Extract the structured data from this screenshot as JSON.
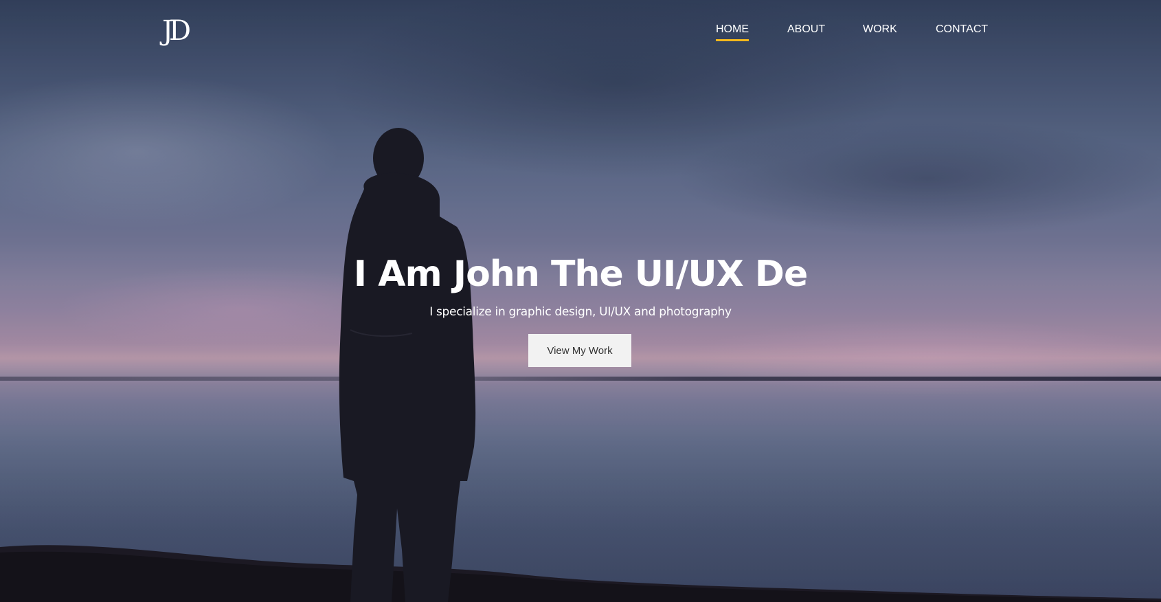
{
  "logo": {
    "text": "JD"
  },
  "nav": {
    "items": [
      {
        "label": "HOME",
        "active": true
      },
      {
        "label": "ABOUT",
        "active": false
      },
      {
        "label": "WORK",
        "active": false
      },
      {
        "label": "CONTACT",
        "active": false
      }
    ],
    "accent_color": "#f4b81c"
  },
  "hero": {
    "title": "I Am John The UI/UX De",
    "subtitle": "I specialize in graphic design, UI/UX and photography",
    "cta_label": "View My Work"
  }
}
